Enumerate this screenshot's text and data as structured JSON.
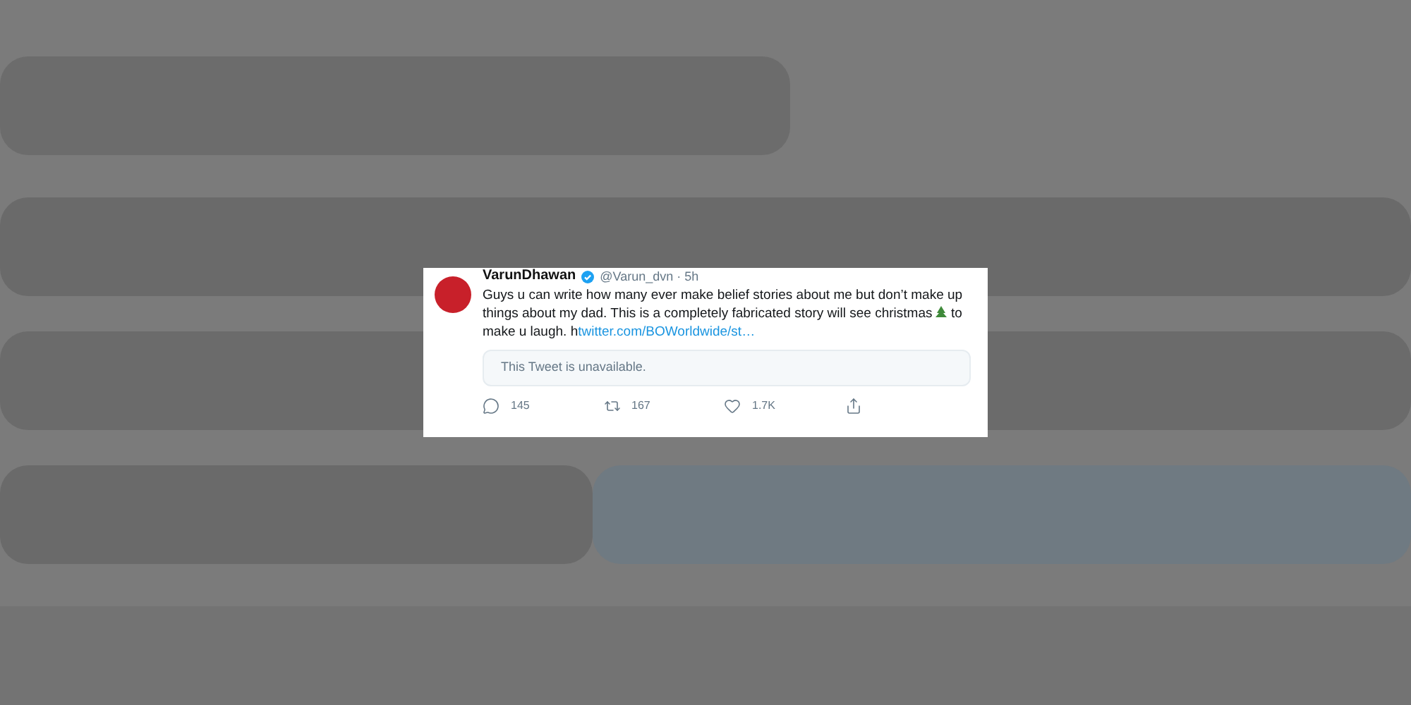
{
  "tweet": {
    "name": "VarunDhawan",
    "verified": true,
    "handle": "@Varun_dvn · 5h",
    "text_before": "Guys u can write how many ever make belief stories about me but don’t make up things about my dad. This is a completely fabricated story will see christmas",
    "text_after": "to make u laugh. h",
    "link": "twitter.com/BOWorldwide/st…",
    "quote": "This Tweet is unavailable.",
    "actions": [
      {
        "kind": "reply",
        "count": "145"
      },
      {
        "kind": "retweet",
        "count": "167"
      },
      {
        "kind": "like",
        "count": "1.7K"
      },
      {
        "kind": "share"
      }
    ]
  }
}
